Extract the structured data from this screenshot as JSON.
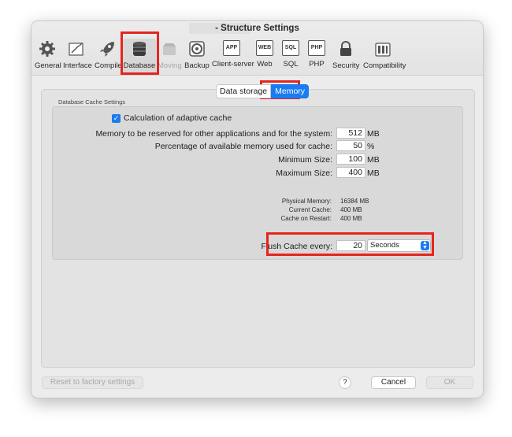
{
  "window": {
    "title": "- Structure Settings"
  },
  "toolbar": {
    "items": [
      {
        "label": "General",
        "icon": "gear-icon"
      },
      {
        "label": "Interface",
        "icon": "interface-icon"
      },
      {
        "label": "Compiler",
        "icon": "rocket-icon"
      },
      {
        "label": "Database",
        "icon": "database-icon"
      },
      {
        "label": "Moving",
        "icon": "moving-icon"
      },
      {
        "label": "Backup",
        "icon": "backup-icon"
      },
      {
        "label": "Client-server",
        "icon": "app-icon",
        "badge": "APP"
      },
      {
        "label": "Web",
        "icon": "web-icon",
        "badge": "WEB"
      },
      {
        "label": "SQL",
        "icon": "sql-icon",
        "badge": "SQL"
      },
      {
        "label": "PHP",
        "icon": "php-icon",
        "badge": "PHP"
      },
      {
        "label": "Security",
        "icon": "lock-icon"
      },
      {
        "label": "Compatibility",
        "icon": "compatibility-icon"
      }
    ]
  },
  "tabs": {
    "data_storage": "Data storage",
    "memory": "Memory"
  },
  "cache": {
    "group_title": "Database Cache Settings",
    "adaptive_label": "Calculation of adaptive cache",
    "reserved_label": "Memory to be reserved for other applications and for the system:",
    "reserved_value": "512",
    "reserved_unit": "MB",
    "percentage_label": "Percentage of available memory used for cache:",
    "percentage_value": "50",
    "percentage_unit": "%",
    "min_label": "Minimum Size:",
    "min_value": "100",
    "min_unit": "MB",
    "max_label": "Maximum Size:",
    "max_value": "400",
    "max_unit": "MB",
    "physical_label": "Physical Memory:",
    "physical_value": "16384  MB",
    "current_label": "Current Cache:",
    "current_value": "400  MB",
    "restart_label": "Cache on Restart:",
    "restart_value": "400  MB",
    "flush_label": "Flush Cache every:",
    "flush_value": "20",
    "flush_unit": "Seconds"
  },
  "footer": {
    "reset": "Reset to factory settings",
    "help": "?",
    "cancel": "Cancel",
    "ok": "OK"
  },
  "colors": {
    "accent": "#1a7bf2",
    "highlight": "#e42520"
  }
}
